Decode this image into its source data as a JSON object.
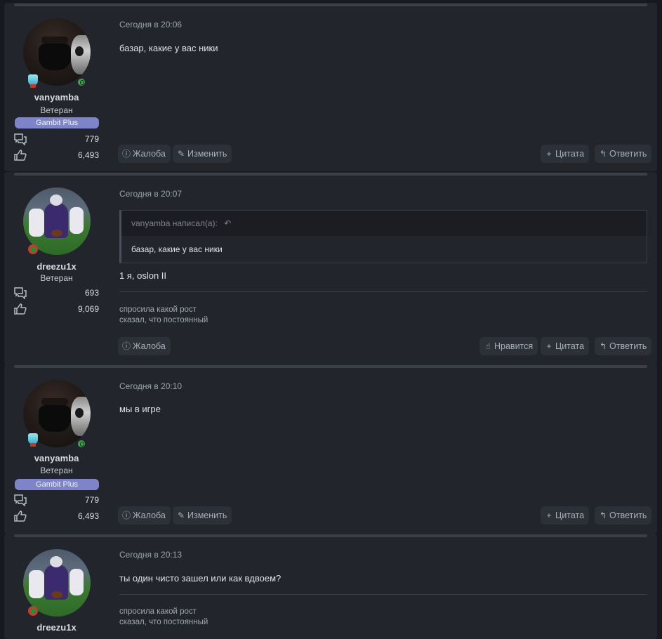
{
  "common": {
    "report_label": "Жалоба",
    "edit_label": "Изменить",
    "like_label": "Нравится",
    "quote_label": "Цитата",
    "reply_label": "Ответить",
    "icons": {
      "report": "report-icon",
      "edit": "pencil-icon",
      "like": "thumbs-up-icon",
      "quote": "plus-icon",
      "reply": "reply-icon",
      "messages": "messages-icon",
      "reactions": "thumbs-up-icon"
    }
  },
  "posts": [
    {
      "author": "vanyamba",
      "user_title": "Ветеран",
      "user_banner": "Gambit Plus",
      "messages_count": "779",
      "reactions_count": "6,493",
      "date": "Сегодня в 20:06",
      "text": "базар, какие у вас ники"
    },
    {
      "author": "dreezu1x",
      "user_title": "Ветеран",
      "messages_count": "693",
      "reactions_count": "9,069",
      "date": "Сегодня в 20:07",
      "quote": {
        "header": "vanyamba написал(а):",
        "text": "базар, какие у вас ники"
      },
      "text": "1 я, oslon II",
      "signature": [
        "спросила какой рост",
        "сказал, что постоянный"
      ]
    },
    {
      "author": "vanyamba",
      "user_title": "Ветеран",
      "user_banner": "Gambit Plus",
      "messages_count": "779",
      "reactions_count": "6,493",
      "date": "Сегодня в 20:10",
      "text": "мы в игре"
    },
    {
      "author": "dreezu1x",
      "date": "Сегодня в 20:13",
      "text": "ты один чисто зашел или как вдвоем?",
      "signature": [
        "спросила какой рост",
        "сказал, что постоянный"
      ]
    }
  ]
}
